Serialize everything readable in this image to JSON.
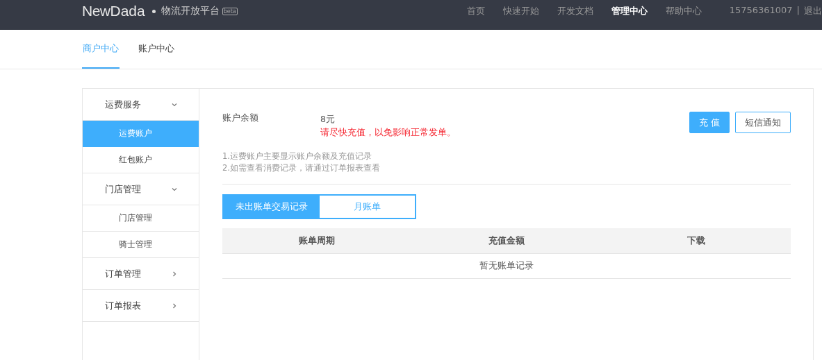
{
  "header": {
    "logo_light": "New",
    "logo_bold": "Dada",
    "platform": "物流开放平台",
    "badge": "beta",
    "nav": [
      {
        "label": "首页",
        "selected": false
      },
      {
        "label": "快速开始",
        "selected": false
      },
      {
        "label": "开发文档",
        "selected": false
      },
      {
        "label": "管理中心",
        "selected": true
      },
      {
        "label": "帮助中心",
        "selected": false
      }
    ],
    "phone": "15756361007",
    "separator": "|",
    "logout": "退出"
  },
  "subnav": [
    {
      "label": "商户中心",
      "selected": true
    },
    {
      "label": "账户中心",
      "selected": false
    }
  ],
  "sidebar": [
    {
      "label": "运费服务",
      "expanded": true,
      "children": [
        {
          "label": "运费账户",
          "selected": true
        },
        {
          "label": "红包账户",
          "selected": false
        }
      ]
    },
    {
      "label": "门店管理",
      "expanded": true,
      "children": [
        {
          "label": "门店管理",
          "selected": false
        },
        {
          "label": "骑士管理",
          "selected": false
        }
      ]
    },
    {
      "label": "订单管理",
      "expanded": false
    },
    {
      "label": "订单报表",
      "expanded": false
    }
  ],
  "balance": {
    "label": "账户余额",
    "amount": "8元",
    "warning": "请尽快充值，以免影响正常发单。"
  },
  "buttons": [
    {
      "label": "充 值",
      "kind": "primary"
    },
    {
      "label": "短信通知",
      "kind": "outline"
    }
  ],
  "notes": [
    "1.运费账户主要显示账户余额及充值记录",
    "2.如需查看消费记录，请通过订单报表查看"
  ],
  "tabs": [
    {
      "label": "未出账单交易记录",
      "selected": true
    },
    {
      "label": "月账单",
      "selected": false
    }
  ],
  "table": {
    "columns": [
      "账单周期",
      "充值金额",
      "下载"
    ],
    "empty": "暂无账单记录"
  }
}
